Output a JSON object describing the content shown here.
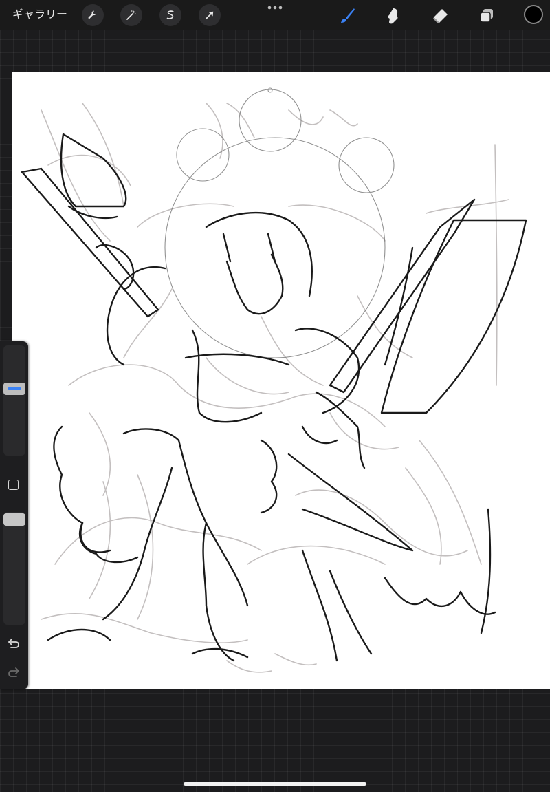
{
  "toolbar": {
    "gallery_label": "ギャラリー",
    "left_tools": [
      {
        "name": "actions",
        "icon": "wrench-icon"
      },
      {
        "name": "adjustments",
        "icon": "magic-wand-icon"
      },
      {
        "name": "selection",
        "icon": "selection-s-icon"
      },
      {
        "name": "transform",
        "icon": "arrow-cursor-icon"
      }
    ],
    "more_icon": "more-dots-icon",
    "right_tools": [
      {
        "name": "brush",
        "icon": "brush-icon",
        "active": true,
        "active_color": "#3b82f6"
      },
      {
        "name": "smudge",
        "icon": "smudge-icon",
        "active": false
      },
      {
        "name": "eraser",
        "icon": "eraser-icon",
        "active": false
      },
      {
        "name": "layers",
        "icon": "layers-icon",
        "active": false
      }
    ],
    "current_color": "#000000"
  },
  "canvas": {
    "background": "#ffffff",
    "content": "sketch-artwork"
  },
  "sidebar": {
    "brush_size_level": 0.62,
    "opacity_level": 1.0,
    "modify_icon": "square-icon",
    "undo_icon": "undo-icon",
    "redo_icon": "redo-icon",
    "accent_color": "#3b82f6"
  }
}
